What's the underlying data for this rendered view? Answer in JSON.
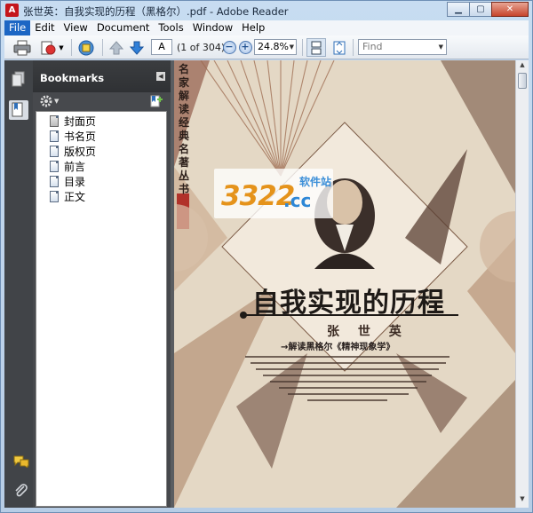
{
  "window": {
    "title": "张世英：自我实现的历程（黑格尔）.pdf - Adobe Reader",
    "app_icon": "adobe-reader-icon"
  },
  "menu": {
    "items": [
      "File",
      "Edit",
      "View",
      "Document",
      "Tools",
      "Window",
      "Help"
    ],
    "active": "File"
  },
  "toolbar": {
    "page_number": "A",
    "page_count": "(1 of 304)",
    "zoom": "24.8%",
    "find_placeholder": "Find"
  },
  "bookmarks": {
    "title": "Bookmarks",
    "items": [
      {
        "label": "封面页",
        "selected": true
      },
      {
        "label": "书名页",
        "selected": false
      },
      {
        "label": "版权页",
        "selected": false
      },
      {
        "label": "前言",
        "selected": false
      },
      {
        "label": "目录",
        "selected": false
      },
      {
        "label": "正文",
        "selected": false
      }
    ]
  },
  "document": {
    "series": "名家解读经典名著丛书",
    "title": "自我实现的历程",
    "author": "张  世  英",
    "subtitle": "→解读黑格尔《精神现象学》",
    "watermark_num": "3322",
    "watermark_cc": ".cc",
    "watermark_cn": "软件站"
  },
  "colors": {
    "accent": "#1c66c4",
    "panel_dark": "#414448",
    "paper": "#e7dccb",
    "watermark_orange": "#e5931b",
    "watermark_blue": "#2d87d6"
  }
}
